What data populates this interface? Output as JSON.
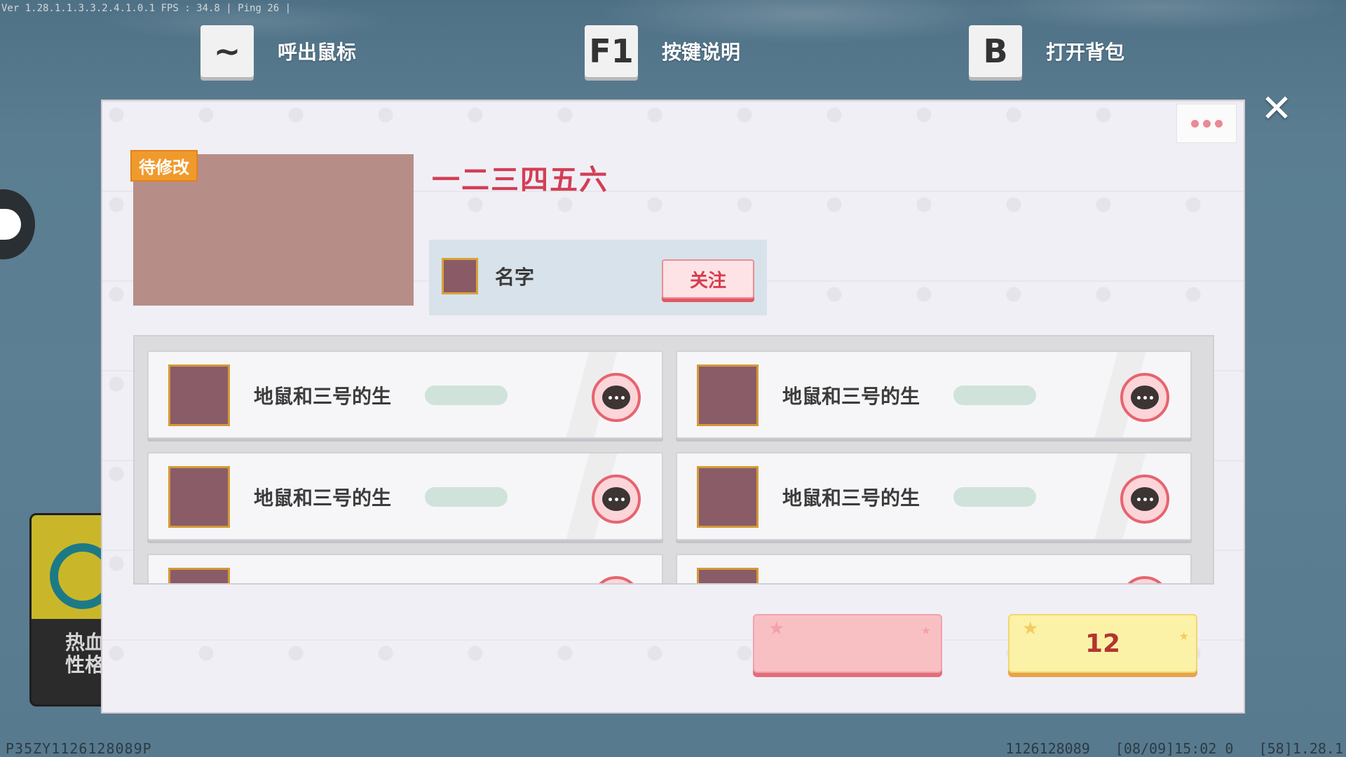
{
  "debug": {
    "top": "Ver 1.28.1.1.3.3.2.4.1.0.1 FPS : 34.8 | Ping 26 |",
    "bottom_left": "P35ZY1126128089P",
    "bottom_right": "1126128089   [08/09]15:02 0   [58]1.28.1"
  },
  "hints": [
    {
      "key": "~",
      "label": "呼出鼠标"
    },
    {
      "key": "F1",
      "label": "按键说明"
    },
    {
      "key": "B",
      "label": "打开背包"
    }
  ],
  "side_card": {
    "text_line1": "热血",
    "text_line2": "性格"
  },
  "panel": {
    "tag": "待修改",
    "title": "一二三四五六",
    "author": {
      "name": "名字",
      "follow_label": "关注"
    },
    "rows": [
      {
        "name": "地鼠和三号的生"
      },
      {
        "name": "地鼠和三号的生"
      },
      {
        "name": "地鼠和三号的生"
      },
      {
        "name": "地鼠和三号的生"
      }
    ],
    "bottom": {
      "left_button_label": "",
      "right_button_label": "12"
    }
  },
  "colors": {
    "title": "#d33e55",
    "tag": "#f09a2c",
    "follow": "#d63c4e",
    "accent_pink": "#f9c0c4",
    "accent_yellow": "#fbf2a7"
  },
  "icons": [
    "close-icon",
    "more-icon",
    "chat-icon"
  ]
}
